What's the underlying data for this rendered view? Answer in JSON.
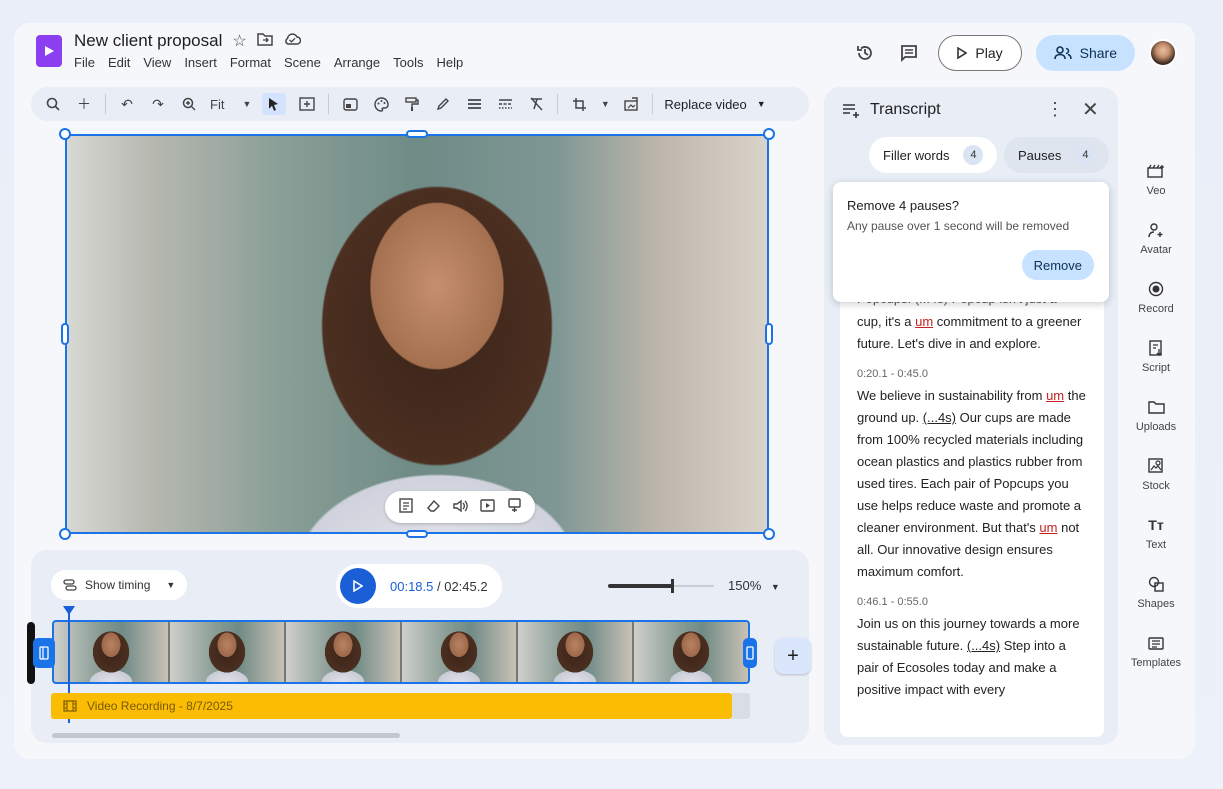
{
  "header": {
    "doc_title": "New client proposal",
    "menu": [
      "File",
      "Edit",
      "View",
      "Insert",
      "Format",
      "Scene",
      "Arrange",
      "Tools",
      "Help"
    ],
    "play_label": "Play",
    "share_label": "Share"
  },
  "toolbar": {
    "zoom_label": "Fit",
    "replace_label": "Replace video"
  },
  "timeline": {
    "show_timing_label": "Show timing",
    "current_time": "00:18.5",
    "duration": "/ 02:45.2",
    "zoom_percent": "150%",
    "zoom_level": 0.6,
    "audio_label": "Video Recording - 8/7/2025"
  },
  "transcript": {
    "title": "Transcript",
    "filler_label": "Filler words",
    "filler_count": "4",
    "pauses_label": "Pauses",
    "pauses_count": "4",
    "popup": {
      "title": "Remove 4 pauses?",
      "subtitle": "Any pause over 1 second will be removed",
      "button": "Remove"
    },
    "seg1": {
      "line_top": "Popcups. (...4s) Popcup isn't just a",
      "a": "cup, it's a ",
      "um": "um",
      "b": " commitment to a greener future. Let's dive in and explore."
    },
    "seg2": {
      "time": "0:20.1 - 0:45.0",
      "a": "We believe in sustainability from ",
      "um1": "um",
      "b": " the ground up. ",
      "pause": "(...4s)",
      "c": " Our cups are made from 100% recycled materials including ocean plastics and plastics rubber from used tires. Each pair of Popcups you use helps reduce waste and promote a cleaner environment. But that's ",
      "um2": "um",
      "d": " not all. Our innovative design ensures maximum comfort."
    },
    "seg3": {
      "time": "0:46.1 - 0:55.0",
      "a": "Join us on this journey towards a more sustainable future. ",
      "pause": "(...4s)",
      "b": " Step into a pair of Ecosoles today and make a positive impact with every"
    }
  },
  "rail": [
    {
      "label": "Veo",
      "icon": "veo-icon"
    },
    {
      "label": "Avatar",
      "icon": "avatar-icon"
    },
    {
      "label": "Record",
      "icon": "record-icon"
    },
    {
      "label": "Script",
      "icon": "script-icon"
    },
    {
      "label": "Uploads",
      "icon": "uploads-icon"
    },
    {
      "label": "Stock",
      "icon": "stock-icon"
    },
    {
      "label": "Text",
      "icon": "text-icon"
    },
    {
      "label": "Shapes",
      "icon": "shapes-icon"
    },
    {
      "label": "Templates",
      "icon": "templates-icon"
    }
  ],
  "colors": {
    "accent": "#1a73e8",
    "brand": "#8b3ff0",
    "audio_track": "#fbbc04",
    "share_bg": "#c6e2ff",
    "filler_red": "#c5221f"
  }
}
